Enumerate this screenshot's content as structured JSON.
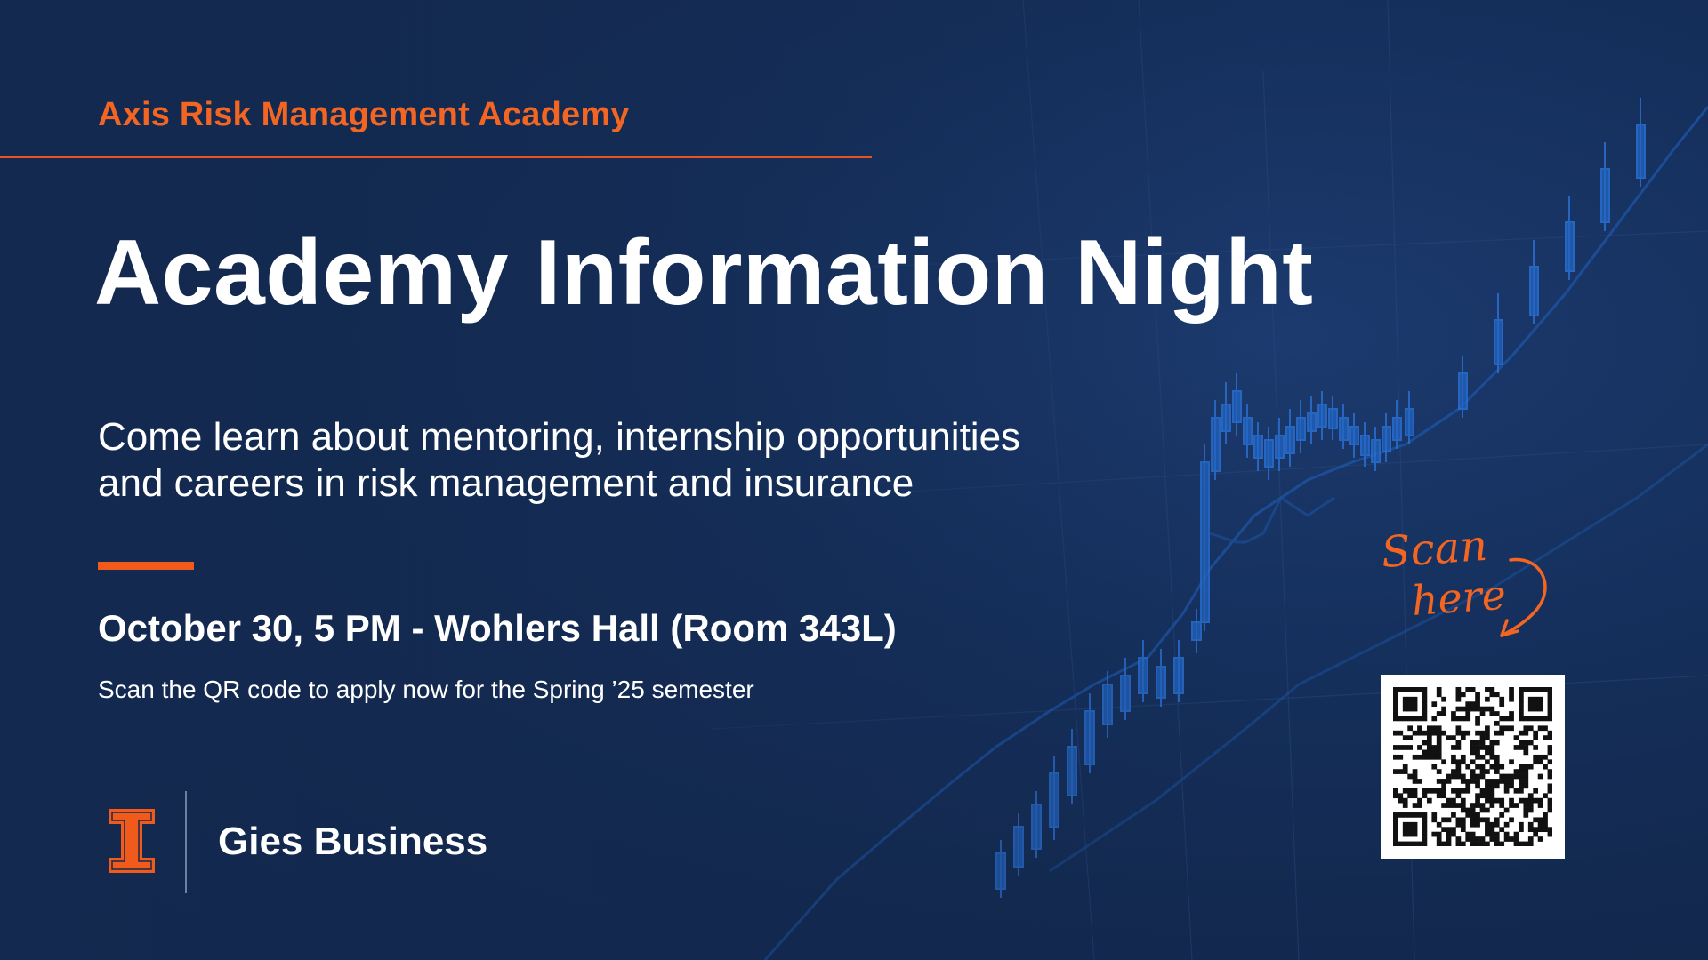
{
  "header": {
    "academy_name": "Axis Risk Management Academy"
  },
  "hero": {
    "title": "Academy Information Night",
    "description_line1": "Come learn about mentoring, internship opportunities",
    "description_line2": "and careers in risk management and insurance"
  },
  "event": {
    "details": "October 30, 5 PM - Wohlers Hall (Room 343L)",
    "apply_note": "Scan the QR code to apply now for the Spring ’25 semester"
  },
  "branding": {
    "name": "Gies Business"
  },
  "cta": {
    "scan_line1": "Scan",
    "scan_line2": "here"
  },
  "colors": {
    "accent": "#f26522",
    "background": "#13294f",
    "chart_blue": "#1f5fb8"
  }
}
